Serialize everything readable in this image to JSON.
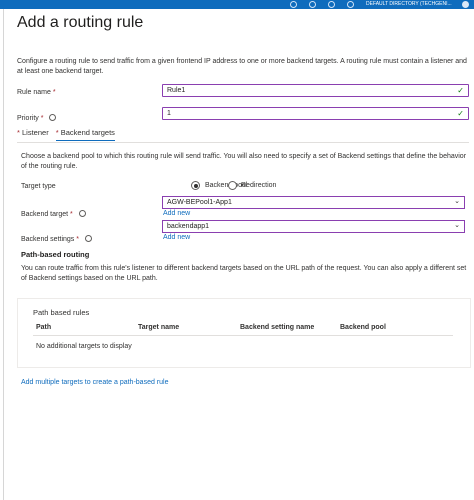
{
  "topbar": {
    "directory": "DEFAULT DIRECTORY (TECHGENI..."
  },
  "title": "Add a routing rule",
  "description": "Configure a routing rule to send traffic from a given frontend IP address to one or more backend targets. A routing rule must contain a listener and at least one backend target.",
  "rule_name": {
    "label": "Rule name",
    "required_mark": "*",
    "value": "Rule1"
  },
  "priority": {
    "label": "Priority",
    "required_mark": "*",
    "value": "1"
  },
  "tabs": [
    {
      "label": "Listener",
      "required_mark": "*"
    },
    {
      "label": "Backend targets",
      "required_mark": "*"
    }
  ],
  "backend_desc": "Choose a backend pool to which this routing rule will send traffic. You will also need to specify a set of Backend settings that define the behavior of the routing rule.",
  "target_type": {
    "label": "Target type",
    "options": [
      "Backend pool",
      "Redirection"
    ],
    "selected": "Backend pool"
  },
  "backend_target": {
    "label": "Backend target",
    "required_mark": "*",
    "value": "AGW-BEPool1-App1",
    "add_new": "Add new"
  },
  "backend_settings": {
    "label": "Backend settings",
    "required_mark": "*",
    "value": "backendapp1",
    "add_new": "Add new"
  },
  "path_routing": {
    "heading": "Path-based routing",
    "description": "You can route traffic from this rule's listener to different backend targets based on the URL path of the request. You can also apply a different set of Backend settings based on the URL path."
  },
  "path_rules": {
    "title": "Path based rules",
    "columns": [
      "Path",
      "Target name",
      "Backend setting name",
      "Backend pool"
    ],
    "empty_message": "No additional targets to display"
  },
  "add_multiple_link": "Add multiple targets to create a path-based rule",
  "colors": {
    "accent": "#0f6cbd",
    "focus_border": "#8a3fb0",
    "valid": "#107c10",
    "required": "#a4262c"
  }
}
